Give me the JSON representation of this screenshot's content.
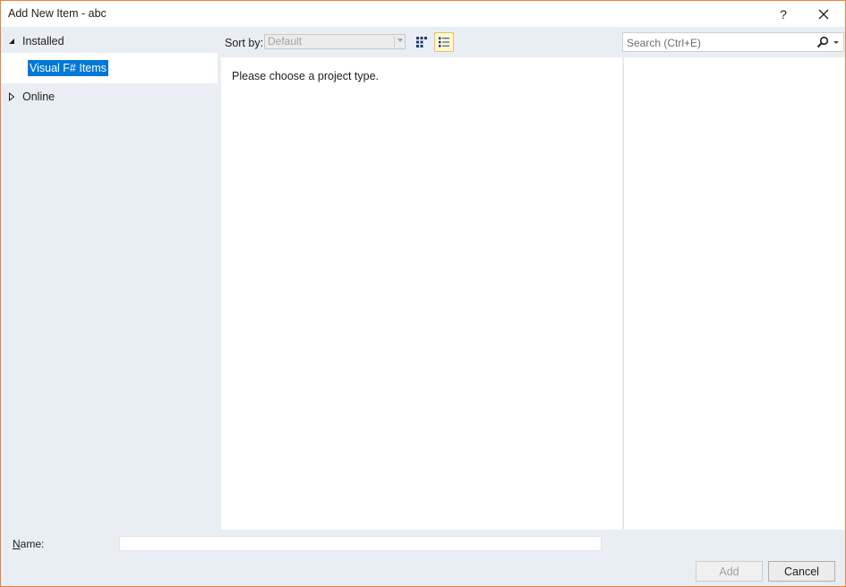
{
  "window": {
    "title": "Add New Item - abc",
    "help_label": "?",
    "close_label": "✕"
  },
  "tree": {
    "installed": "Installed",
    "selected": "Visual F# Items",
    "online": "Online"
  },
  "toolbar": {
    "sort_label": "Sort by:",
    "sort_value": "Default",
    "search_placeholder": "Search (Ctrl+E)",
    "icons": [
      "grid-view-icon",
      "list-view-icon",
      "search-icon",
      "dropdown-icon"
    ]
  },
  "center": {
    "message": "Please choose a project type."
  },
  "bottom": {
    "name_label_first": "N",
    "name_label_rest": "ame:",
    "name_value": "",
    "add_label": "Add",
    "cancel_label": "Cancel"
  },
  "colors": {
    "accent_border": "#e8823c",
    "selection": "#0078d7",
    "pane_bg": "#e9edf4"
  }
}
